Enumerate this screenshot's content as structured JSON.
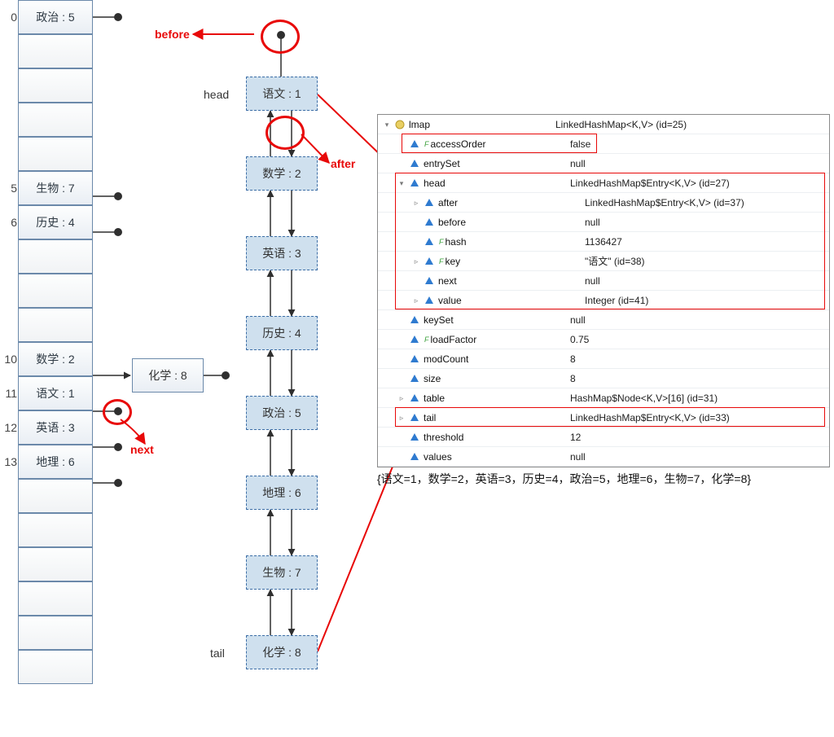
{
  "hash_table": {
    "bucket_count": 20,
    "buckets": [
      {
        "index": 0,
        "label": "政治 : 5"
      },
      {
        "index": 5,
        "label": "生物 : 7"
      },
      {
        "index": 6,
        "label": "历史 : 4"
      },
      {
        "index": 10,
        "label": "数学 : 2",
        "overflow": {
          "label": "化学 : 8"
        }
      },
      {
        "index": 11,
        "label": "语文 : 1"
      },
      {
        "index": 12,
        "label": "英语 : 3"
      },
      {
        "index": 13,
        "label": "地理 : 6"
      }
    ]
  },
  "linked_list": {
    "head_label": "head",
    "tail_label": "tail",
    "nodes": [
      {
        "label": "语文 : 1"
      },
      {
        "label": "数学 : 2"
      },
      {
        "label": "英语 : 3"
      },
      {
        "label": "历史 : 4"
      },
      {
        "label": "政治 : 5"
      },
      {
        "label": "地理 : 6"
      },
      {
        "label": "生物 : 7"
      },
      {
        "label": "化学 : 8"
      }
    ]
  },
  "annotations": {
    "before": "before",
    "after": "after",
    "next": "next"
  },
  "debugger": {
    "root": {
      "name": "lmap",
      "value": "LinkedHashMap<K,V>  (id=25)"
    },
    "rows": [
      {
        "depth": 1,
        "tw": "",
        "f": true,
        "name": "accessOrder",
        "value": "false"
      },
      {
        "depth": 1,
        "tw": "",
        "f": false,
        "name": "entrySet",
        "value": "null"
      },
      {
        "depth": 1,
        "tw": "open",
        "f": false,
        "name": "head",
        "value": "LinkedHashMap$Entry<K,V>  (id=27)"
      },
      {
        "depth": 2,
        "tw": "close",
        "f": false,
        "name": "after",
        "value": "LinkedHashMap$Entry<K,V>  (id=37)"
      },
      {
        "depth": 2,
        "tw": "",
        "f": false,
        "name": "before",
        "value": "null"
      },
      {
        "depth": 2,
        "tw": "",
        "f": true,
        "name": "hash",
        "value": "1136427"
      },
      {
        "depth": 2,
        "tw": "close",
        "f": true,
        "name": "key",
        "value": "\"语文\" (id=38)"
      },
      {
        "depth": 2,
        "tw": "",
        "f": false,
        "name": "next",
        "value": "null"
      },
      {
        "depth": 2,
        "tw": "close",
        "f": false,
        "name": "value",
        "value": "Integer  (id=41)"
      },
      {
        "depth": 1,
        "tw": "",
        "f": false,
        "name": "keySet",
        "value": "null"
      },
      {
        "depth": 1,
        "tw": "",
        "f": true,
        "name": "loadFactor",
        "value": "0.75"
      },
      {
        "depth": 1,
        "tw": "",
        "f": false,
        "name": "modCount",
        "value": "8"
      },
      {
        "depth": 1,
        "tw": "",
        "f": false,
        "name": "size",
        "value": "8"
      },
      {
        "depth": 1,
        "tw": "close",
        "f": false,
        "name": "table",
        "value": "HashMap$Node<K,V>[16]  (id=31)"
      },
      {
        "depth": 1,
        "tw": "close",
        "f": false,
        "name": "tail",
        "value": "LinkedHashMap$Entry<K,V>  (id=33)"
      },
      {
        "depth": 1,
        "tw": "",
        "f": false,
        "name": "threshold",
        "value": "12"
      },
      {
        "depth": 1,
        "tw": "",
        "f": false,
        "name": "values",
        "value": "null"
      }
    ]
  },
  "toString": "{语文=1，数学=2，英语=3，历史=4，政治=5，地理=6，生物=7，化学=8}",
  "chart_data": {
    "type": "table",
    "title": "LinkedHashMap internal structure",
    "hash_buckets_total": 16,
    "entries_in_insertion_order": [
      {
        "key": "语文",
        "value": 1,
        "bucket": 11
      },
      {
        "key": "数学",
        "value": 2,
        "bucket": 10
      },
      {
        "key": "英语",
        "value": 3,
        "bucket": 12
      },
      {
        "key": "历史",
        "value": 4,
        "bucket": 6
      },
      {
        "key": "政治",
        "value": 5,
        "bucket": 0
      },
      {
        "key": "地理",
        "value": 6,
        "bucket": 13
      },
      {
        "key": "生物",
        "value": 7,
        "bucket": 5
      },
      {
        "key": "化学",
        "value": 8,
        "bucket": 10
      }
    ],
    "debug_values": {
      "accessOrder": false,
      "entrySet": null,
      "head": {
        "key": "语文",
        "hash": 1136427,
        "before": null,
        "after_id": 37,
        "next": null,
        "value_type": "Integer"
      },
      "keySet": null,
      "loadFactor": 0.75,
      "modCount": 8,
      "size": 8,
      "table_length": 16,
      "tail_id": 33,
      "threshold": 12,
      "values": null
    }
  }
}
